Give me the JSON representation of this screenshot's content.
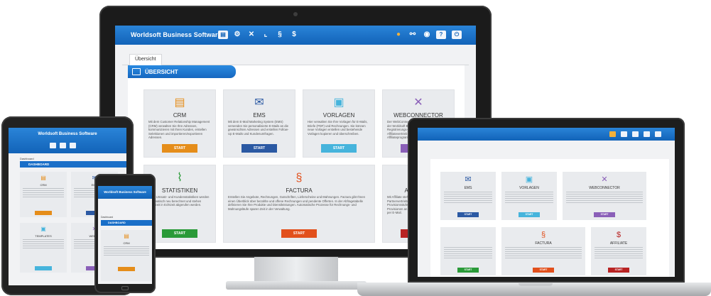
{
  "app": {
    "title": "Worldsoft Business Software"
  },
  "toolbar_icons": [
    "contacts-icon",
    "network-icon",
    "tools-icon",
    "chart-icon",
    "invoice-icon",
    "dollar-icon"
  ],
  "header_right_icons": [
    "badge-user-icon",
    "link-icon",
    "user-icon",
    "help-icon",
    "power-icon"
  ],
  "tabs": [
    {
      "label": "Übersicht"
    }
  ],
  "section": {
    "title": "ÜBERSICHT"
  },
  "cards": [
    {
      "title": "CRM",
      "icon": "crm-icon",
      "glyph": "▤",
      "color": "#e58d1a",
      "button": "START",
      "description": "Mit dem Customer Relationship Management (CRM) verwalten Sie Ihre Adressen, kommunizieren mit Ihren Kunden, erstellen Selektionen und importieren/exportieren Adressen."
    },
    {
      "title": "EMS",
      "icon": "ems-icon",
      "glyph": "✉",
      "color": "#2b59a3",
      "button": "START",
      "description": "Mit dem E-Mail Marketing System (EMS) versenden Sie personalisierte E-Mails an die gewünschten Adressen und erstellen Follow-Up E-Mails und Kundenumfragen."
    },
    {
      "title": "VORLAGEN",
      "icon": "templates-icon",
      "glyph": "▣",
      "color": "#46b4dc",
      "button": "START",
      "description": "Hier verwalten Sie Ihre Vorlagen für E-Mails, Briefe (PDF) und Rechnungen. Sie können neue Vorlagen erstellen und bestehende Vorlagen kopieren und überschreiben."
    },
    {
      "title": "WEBCONNECTOR",
      "icon": "webconnector-icon",
      "glyph": "✕",
      "color": "#8a5fb8",
      "button": "START",
      "description": "Der WebConnector verbindet Ihre Website mit der Worldsoft Business Software: Registrierungs- und Bestellformulare, Affiliatevertrieb (Quick Shop) und Affiliateprogramm stehen zur Verfügung."
    },
    {
      "title": "STATISTIKEN",
      "icon": "statistics-icon",
      "glyph": "📈",
      "color": "#2a9a38",
      "button": "START",
      "description": "Viele Umsatz- und Kundenstatistiken werden automatisch neu berechnet und stehen jederzeit in Echtzeit abgerufen werden."
    },
    {
      "title": "FACTURA",
      "icon": "factura-icon",
      "glyph": "§",
      "color": "#e2501c",
      "button": "START",
      "description": "Erstellen Sie Angebote, Rechnungen, Gutschriften, Lieferscheine und Mahnungen. Factura gibt Ihnen einen Überblick über bezahlte und offene Rechnungen und pendente Offerten. In der Abfragetabelle definieren Sie Ihre Produkte und Dienstleistungen. Automatische Prozesse für Rechnungs- und Mahnungsläufe sparen Zeit in der Verwaltung."
    },
    {
      "title": "AFFILIATE",
      "icon": "affiliate-icon",
      "glyph": "$",
      "color": "#b82323",
      "button": "START",
      "description": "Mit Affiliate steht Ihnen ein komplettes Partnervertriebs-System zur Verfügung. Provisionsstufe rechnen automatisch fällige Provisionen an und informieren den Partner per E-Mail."
    }
  ],
  "tablet": {
    "title": "Worldsoft Business Software",
    "dashboard_label": "Dashboard",
    "dashboard_title": "DASHBOARD",
    "cards": [
      {
        "title": "CRM",
        "glyph": "▤",
        "color": "#e58d1a"
      },
      {
        "title": "EMS",
        "glyph": "✉",
        "color": "#2b59a3"
      },
      {
        "title": "TEMPLATES",
        "glyph": "▣",
        "color": "#46b4dc"
      },
      {
        "title": "WEBCO",
        "glyph": "✕",
        "color": "#8a5fb8"
      }
    ]
  },
  "phone": {
    "title": "Worldsoft Business Software",
    "dashboard_label": "Dashboard",
    "dashboard_title": "DASHBOARD",
    "card": {
      "title": "CRM",
      "glyph": "▤",
      "color": "#e58d1a"
    }
  },
  "laptop": {
    "cards": [
      {
        "title": "EMS",
        "glyph": "✉",
        "color": "#2b59a3",
        "button": "START"
      },
      {
        "title": "VORLAGEN",
        "glyph": "▣",
        "color": "#46b4dc",
        "button": "START"
      },
      {
        "title": "WEBCONNECTOR",
        "glyph": "✕",
        "color": "#8a5fb8",
        "button": "START"
      },
      {
        "title": "",
        "glyph": "",
        "color": "#2a9a38",
        "button": "START"
      },
      {
        "title": "FACTURA",
        "glyph": "§",
        "color": "#e2501c",
        "button": "START"
      },
      {
        "title": "AFFILIATE",
        "glyph": "$",
        "color": "#b82323",
        "button": "START"
      }
    ]
  }
}
